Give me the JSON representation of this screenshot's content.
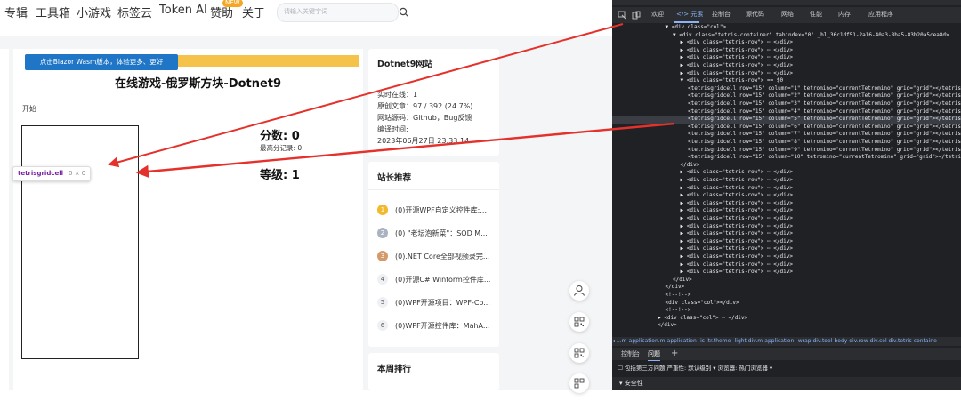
{
  "nav": {
    "items": [
      "专辑",
      "工具箱",
      "小游戏",
      "标签云",
      "Token AI",
      "赞助",
      "关于"
    ],
    "badge": "NEW",
    "search_placeholder": "请输入关键字词"
  },
  "main": {
    "banner": "点击Blazor Wasm版本，体验更多、更好",
    "title": "在线游戏-俄罗斯方块-Dotnet9",
    "start": "开始",
    "score": "分数: 0",
    "best": "最高分记录: 0",
    "level": "等级: 1",
    "tooltip_name": "tetrisgridcell",
    "tooltip_size": "0 × 0"
  },
  "sidebar": {
    "site_title": "Dotnet9网站",
    "info": [
      "实时在线：1",
      "原创文章：97 / 392 (24.7%)",
      "网站源码：Github，Bug反馈",
      "编译时间:",
      "2023年06月27日 23:33:14"
    ],
    "rec_title": "站长推荐",
    "rec_items": [
      {
        "rank": "1",
        "text": "(0)开源WPF自定义控件库:..."
      },
      {
        "rank": "2",
        "text": "(0) \"老坛泡新菜\"：SOD M..."
      },
      {
        "rank": "3",
        "text": "(0).NET Core全部视频录完..."
      },
      {
        "rank": "4",
        "text": "(0)开源C# Winform控件库..."
      },
      {
        "rank": "5",
        "text": "(0)WPF开源项目：WPF-Co..."
      },
      {
        "rank": "6",
        "text": "(0)WPF开源控件库：MahA..."
      }
    ],
    "week_title": "本周排行"
  },
  "devtools": {
    "tabs": [
      "欢迎",
      "</> 元素",
      "控制台",
      "源代码",
      "网络",
      "性能",
      "内存",
      "应用程序"
    ],
    "lines": [
      {
        "indent": 7,
        "text": "▼ <div class=\"col\">"
      },
      {
        "indent": 8,
        "text": "▼ <div class=\"tetris-container\" tabindex=\"0\" _bl_36c1df51-2a16-40a3-8ba5-83b20a5cea8d>"
      },
      {
        "indent": 9,
        "text": "▶ <div class=\"tetris-row\"> ⋯ </div>"
      },
      {
        "indent": 9,
        "text": "▶ <div class=\"tetris-row\"> ⋯ </div>"
      },
      {
        "indent": 9,
        "text": "▶ <div class=\"tetris-row\"> ⋯ </div>"
      },
      {
        "indent": 9,
        "text": "▶ <div class=\"tetris-row\"> ⋯ </div>"
      },
      {
        "indent": 9,
        "text": "▶ <div class=\"tetris-row\"> ⋯ </div>"
      },
      {
        "indent": 9,
        "text": "▼ <div class=\"tetris-row\"> == $0"
      },
      {
        "indent": 10,
        "text": "<tetrisgridcell row=\"15\" column=\"1\" tetromino=\"currentTetromino\" grid=\"grid\"></tetrisg"
      },
      {
        "indent": 10,
        "text": "<tetrisgridcell row=\"15\" column=\"2\" tetromino=\"currentTetromino\" grid=\"grid\"></tetrisg"
      },
      {
        "indent": 10,
        "text": "<tetrisgridcell row=\"15\" column=\"3\" tetromino=\"currentTetromino\" grid=\"grid\"></tetrisg"
      },
      {
        "indent": 10,
        "text": "<tetrisgridcell row=\"15\" column=\"4\" tetromino=\"currentTetromino\" grid=\"grid\"></tetrisg"
      },
      {
        "indent": 10,
        "text": "<tetrisgridcell row=\"15\" column=\"5\" tetromino=\"currentTetromino\" grid=\"grid\"></tetrisg",
        "hl": true
      },
      {
        "indent": 10,
        "text": "<tetrisgridcell row=\"15\" column=\"6\" tetromino=\"currentTetromino\" grid=\"grid\"></tetrisg"
      },
      {
        "indent": 10,
        "text": "<tetrisgridcell row=\"15\" column=\"7\" tetromino=\"currentTetromino\" grid=\"grid\"></tetrisg"
      },
      {
        "indent": 10,
        "text": "<tetrisgridcell row=\"15\" column=\"8\" tetromino=\"currentTetromino\" grid=\"grid\"></tetrisg"
      },
      {
        "indent": 10,
        "text": "<tetrisgridcell row=\"15\" column=\"9\" tetromino=\"currentTetromino\" grid=\"grid\"></tetrisg"
      },
      {
        "indent": 10,
        "text": "<tetrisgridcell row=\"15\" column=\"10\" tetromino=\"currentTetromino\" grid=\"grid\"></tetris"
      },
      {
        "indent": 9,
        "text": "</div>"
      },
      {
        "indent": 9,
        "text": "▶ <div class=\"tetris-row\"> ⋯ </div>"
      },
      {
        "indent": 9,
        "text": "▶ <div class=\"tetris-row\"> ⋯ </div>"
      },
      {
        "indent": 9,
        "text": "▶ <div class=\"tetris-row\"> ⋯ </div>"
      },
      {
        "indent": 9,
        "text": "▶ <div class=\"tetris-row\"> ⋯ </div>"
      },
      {
        "indent": 9,
        "text": "▶ <div class=\"tetris-row\"> ⋯ </div>"
      },
      {
        "indent": 9,
        "text": "▶ <div class=\"tetris-row\"> ⋯ </div>"
      },
      {
        "indent": 9,
        "text": "▶ <div class=\"tetris-row\"> ⋯ </div>"
      },
      {
        "indent": 9,
        "text": "▶ <div class=\"tetris-row\"> ⋯ </div>"
      },
      {
        "indent": 9,
        "text": "▶ <div class=\"tetris-row\"> ⋯ </div>"
      },
      {
        "indent": 9,
        "text": "▶ <div class=\"tetris-row\"> ⋯ </div>"
      },
      {
        "indent": 9,
        "text": "▶ <div class=\"tetris-row\"> ⋯ </div>"
      },
      {
        "indent": 9,
        "text": "▶ <div class=\"tetris-row\"> ⋯ </div>"
      },
      {
        "indent": 9,
        "text": "▶ <div class=\"tetris-row\"> ⋯ </div>"
      },
      {
        "indent": 9,
        "text": "▶ <div class=\"tetris-row\"> ⋯ </div>"
      },
      {
        "indent": 8,
        "text": "</div>"
      },
      {
        "indent": 7,
        "text": "</div>"
      },
      {
        "indent": 7,
        "text": "<!--!-->"
      },
      {
        "indent": 7,
        "text": "<div class=\"col\"></div>"
      },
      {
        "indent": 7,
        "text": "<!--!-->"
      },
      {
        "indent": 6,
        "text": "▶ <div class=\"col\"> ⋯ </div>"
      },
      {
        "indent": 6,
        "text": "</div>"
      }
    ],
    "breadcrumb": "◂ ...m-application.m-application--is-ltr.theme--light   div.m-application--wrap   div.tool-body   div.row   div.col   div.tetris-containe",
    "bottom_tabs": [
      "控制台",
      "问题"
    ],
    "filter_text": "☐ 包括第三方问题   严重性: 默认级别 ▾   浏览器: 热门浏览器 ▾",
    "section": "▾ 安全性"
  },
  "float_buttons": [
    "user-icon",
    "qr-icon",
    "qr-icon",
    "qr-icon"
  ],
  "colors": {
    "accent": "#1f75c6",
    "banner_yellow": "#f6c34a",
    "arrow": "#e5312b"
  }
}
